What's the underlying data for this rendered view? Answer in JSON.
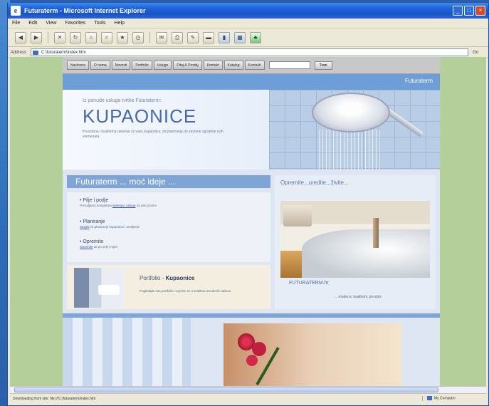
{
  "window": {
    "title": "Futuraterm - Microsoft Internet Explorer",
    "icon": "ie-icon",
    "buttons": [
      "minimize",
      "maximize",
      "close"
    ]
  },
  "menubar": [
    "File",
    "Edit",
    "View",
    "Favorites",
    "Tools",
    "Help"
  ],
  "toolbar": {
    "icons": [
      "back-icon",
      "forward-icon",
      "stop-icon",
      "refresh-icon",
      "home-icon",
      "search-icon",
      "favorites-icon",
      "history-icon",
      "mail-icon",
      "print-icon",
      "edit-icon",
      "discuss-icon",
      "messenger-icon",
      "research-icon",
      "extra-icon"
    ]
  },
  "address": {
    "label": "Address",
    "value": "C:\\futuraterm\\index.htm",
    "go_label": "Go"
  },
  "site": {
    "nav": [
      "Naslovna",
      "O nama",
      "Novosti",
      "Portfolio",
      "Usluge",
      "Pitaj & Prodaj",
      "Kontakt",
      "Katalog",
      "Kontakti"
    ],
    "nav_button": "Trazi",
    "strip_text": "Futuraterm",
    "hero": {
      "subtitle": "Iz ponude usluga tvrtke Futuraterm:",
      "title": "KUPAONICE",
      "text": "Pouzdana i kvalitetna rjesenja za vasu kupaonicu, od planiranja do zavrsne ugradnje svih elemenata."
    },
    "band_title": "Futuraterm ... moć ideje ...",
    "features": [
      {
        "title": "Pilje i podje",
        "desc_pre": "Ponudjamo kompletna ",
        "desc_link": "rjesenja i usluge",
        "desc_post": " za vas prostor"
      },
      {
        "title": "Planiranje",
        "desc_pre": "",
        "desc_link": "Savjeti",
        "desc_post": " za planiranje kupaonice i uredjenje"
      },
      {
        "title": "Opremite",
        "desc_pre": "",
        "desc_link": "Opremite",
        "desc_post": " se po zelji i mjeri"
      }
    ],
    "portfolio": {
      "title_pre": "Portfolio - ",
      "title_bold": "Kupaonice",
      "text": "Pogledajte nas portfolio i uvjerite se u kvalitetu izvedenih radova."
    },
    "right_col": {
      "heading": "Opremite...uredite...živite...",
      "brand": "FUTURATERM.hr",
      "tagline": "... moderni, kvalitetni, povoljni"
    }
  },
  "statusbar": {
    "text": "Downloading from site: file:///C:/futuraterm/index.htm",
    "zone": "My Computer"
  }
}
